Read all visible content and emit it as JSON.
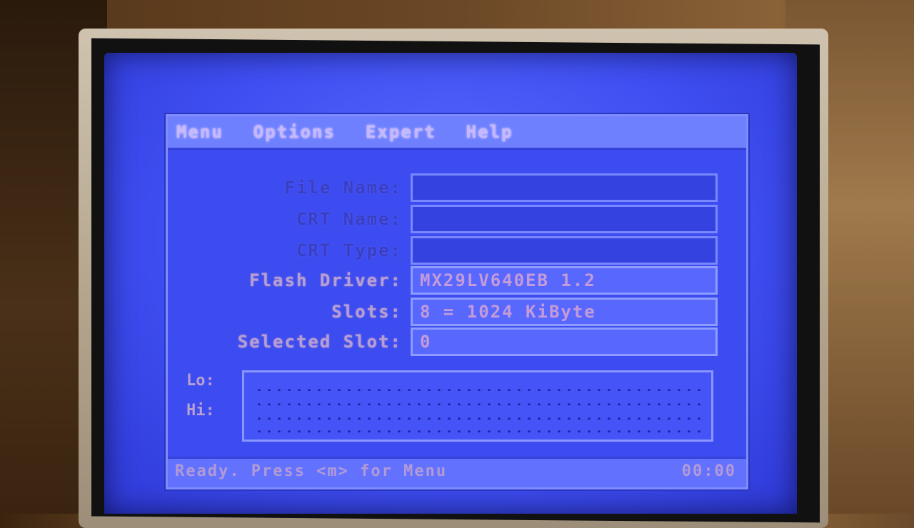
{
  "menu": {
    "items": [
      "Menu",
      "Options",
      "Expert",
      "Help"
    ]
  },
  "fields": [
    {
      "label": "File Name:",
      "value": "",
      "dim": true
    },
    {
      "label": "CRT Name:",
      "value": "",
      "dim": true
    },
    {
      "label": "CRT Type:",
      "value": "",
      "dim": true
    },
    {
      "label": "Flash Driver:",
      "value": "MX29LV640EB 1.2",
      "dim": false
    },
    {
      "label": "Slots:",
      "value": "8 = 1024 KiByte",
      "dim": false
    },
    {
      "label": "Selected Slot:",
      "value": "0",
      "dim": false
    }
  ],
  "io": {
    "lo_label": "Lo:",
    "hi_label": "Hi:"
  },
  "status": {
    "text": "Ready. Press <m> for Menu",
    "time": "00:00"
  }
}
